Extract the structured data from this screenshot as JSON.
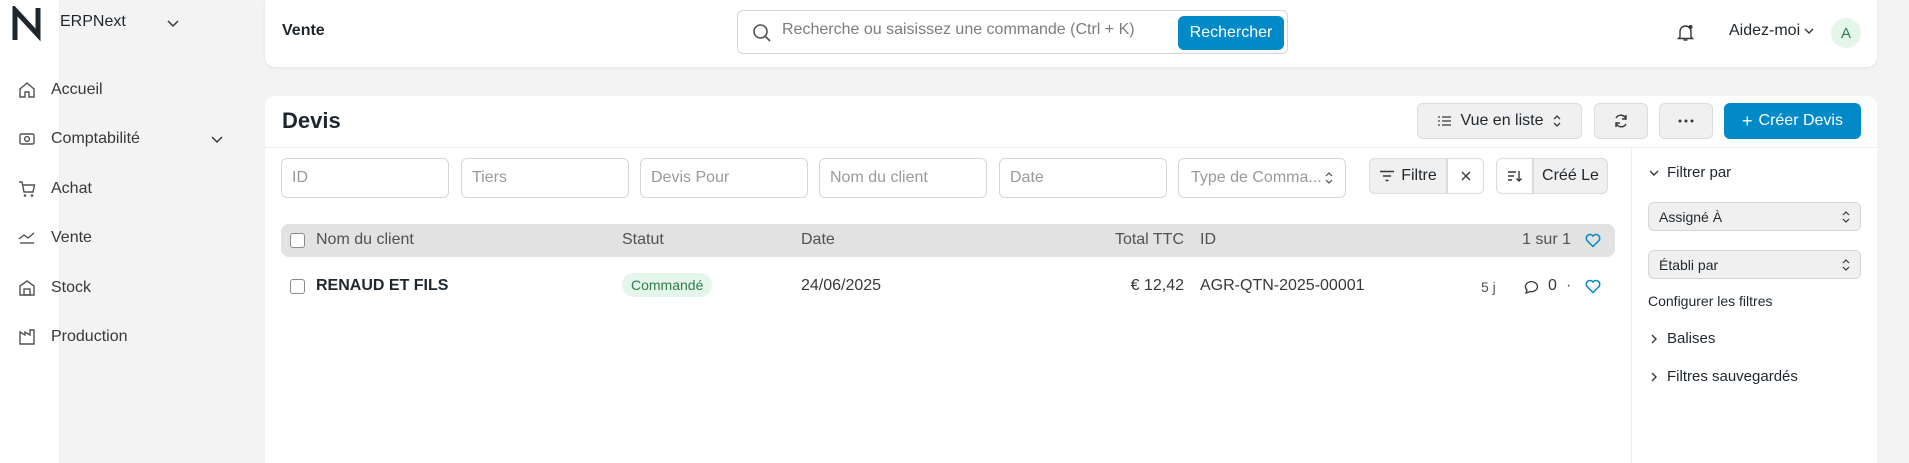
{
  "app": {
    "name": "ERPNext"
  },
  "sidebar": {
    "items": [
      {
        "label": "Accueil",
        "icon": "home-icon"
      },
      {
        "label": "Comptabilité",
        "icon": "accounting-icon"
      },
      {
        "label": "Achat",
        "icon": "cart-icon"
      },
      {
        "label": "Vente",
        "icon": "sales-icon"
      },
      {
        "label": "Stock",
        "icon": "stock-icon"
      },
      {
        "label": "Production",
        "icon": "production-icon"
      }
    ]
  },
  "navbar": {
    "breadcrumb": "Vente",
    "search_placeholder": "Recherche ou saisissez une commande (Ctrl + K)",
    "search_button": "Rechercher",
    "help_label": "Aidez-moi",
    "avatar_initial": "A"
  },
  "page": {
    "title": "Devis",
    "view_label": "Vue en liste",
    "create_label": "Créer Devis"
  },
  "filters": {
    "id_placeholder": "ID",
    "tiers_placeholder": "Tiers",
    "devis_pour_placeholder": "Devis Pour",
    "client_placeholder": "Nom du client",
    "date_placeholder": "Date",
    "type_commande": "Type de Comma...",
    "filter_label": "Filtre",
    "sort_label": "Créé Le"
  },
  "list": {
    "columns": [
      "Nom du client",
      "Statut",
      "Date",
      "Total TTC",
      "ID"
    ],
    "count_label": "1 sur 1",
    "rows": [
      {
        "client": "RENAUD ET FILS",
        "status": "Commandé",
        "date": "24/06/2025",
        "total": "€ 12,42",
        "id": "AGR-QTN-2025-00001",
        "age": "5 j",
        "comments": "0",
        "separator": "·"
      }
    ]
  },
  "side_panel": {
    "filter_by": "Filtrer par",
    "assigned_to": "Assigné À",
    "created_by": "Établi par",
    "configure_filters": "Configurer les filtres",
    "tags": "Balises",
    "saved_filters": "Filtres sauvegardés"
  },
  "colors": {
    "primary": "#0289c7",
    "status_green_bg": "#e4f5e9",
    "status_green_text": "#2f7d4a",
    "header_bg": "#e2e2e2"
  }
}
